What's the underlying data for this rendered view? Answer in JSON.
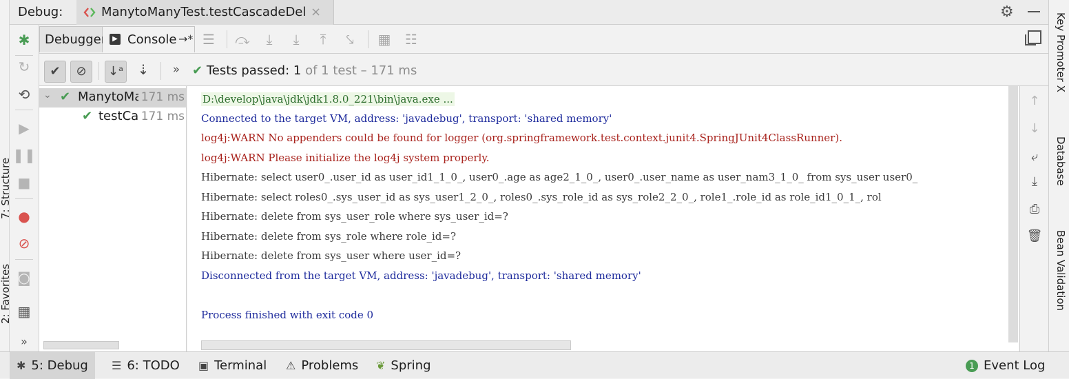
{
  "header": {
    "debug_label": "Debug:",
    "tab_label": "ManytoManyTest.testCascadeDel",
    "tab_close": "×"
  },
  "left_strip": {
    "structure_label": "7: Structure",
    "favorites_label": "2: Favorites"
  },
  "tool_tabs": {
    "debugger_label": "Debugger",
    "console_label": "Console",
    "console_pin": "→*"
  },
  "test_toolbar": {
    "more": "»",
    "passed_label": "Tests passed:",
    "passed_count": "1",
    "passed_detail": "of 1 test – 171 ms"
  },
  "tree": {
    "items": [
      {
        "name": "ManytoManyTest",
        "time": "171 ms",
        "status": "passed"
      },
      {
        "name": "testCascadeDel",
        "time": "171 ms",
        "status": "passed"
      }
    ]
  },
  "console": {
    "lines": [
      {
        "text": "D:\\develop\\java\\jdk\\jdk1.8.0_221\\bin\\java.exe ...",
        "style": "green"
      },
      {
        "text": "Connected to the target VM, address: 'javadebug', transport: 'shared memory'",
        "style": "blue"
      },
      {
        "text": "log4j:WARN No appenders could be found for logger (org.springframework.test.context.junit4.SpringJUnit4ClassRunner).",
        "style": "red"
      },
      {
        "text": "log4j:WARN Please initialize the log4j system properly.",
        "style": "red"
      },
      {
        "text": "Hibernate: select user0_.user_id as user_id1_1_0_, user0_.age as age2_1_0_, user0_.user_name as user_nam3_1_0_ from sys_user user0_",
        "style": "gray"
      },
      {
        "text": "Hibernate: select roles0_.sys_user_id as sys_user1_2_0_, roles0_.sys_role_id as sys_role2_2_0_, role1_.role_id as role_id1_0_1_, rol",
        "style": "gray"
      },
      {
        "text": "Hibernate: delete from sys_user_role where sys_user_id=?",
        "style": "gray"
      },
      {
        "text": "Hibernate: delete from sys_role where role_id=?",
        "style": "gray"
      },
      {
        "text": "Hibernate: delete from sys_user where user_id=?",
        "style": "gray"
      },
      {
        "text": "Disconnected from the target VM, address: 'javadebug', transport: 'shared memory'",
        "style": "blue"
      },
      {
        "text": "",
        "style": "gray"
      },
      {
        "text": "Process finished with exit code 0",
        "style": "blue"
      }
    ]
  },
  "right_strip": {
    "key_promoter": "Key Promoter X",
    "database": "Database",
    "bean_validation": "Bean Validation"
  },
  "bottom_bar": {
    "debug": "5: Debug",
    "todo": "6: TODO",
    "terminal": "Terminal",
    "problems": "Problems",
    "spring": "Spring",
    "event_log": "Event Log",
    "event_count": "1"
  },
  "colors": {
    "passed_green": "#499c54",
    "console_blue": "#1d2a9c",
    "console_red": "#a8221c"
  }
}
